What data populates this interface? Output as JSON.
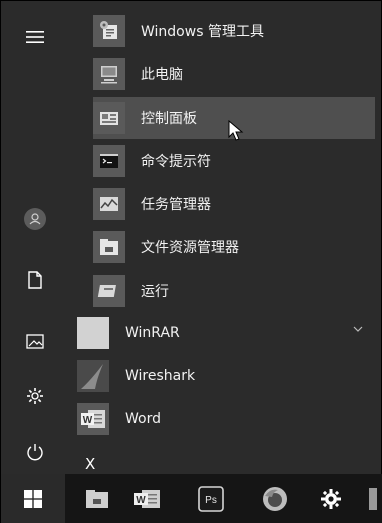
{
  "rail": {
    "icons": [
      "hamburger-icon",
      "user-avatar-icon",
      "document-icon",
      "pictures-icon",
      "settings-icon",
      "power-icon"
    ]
  },
  "menu": {
    "items": [
      {
        "label": "Windows 管理工具",
        "icon": "admin-tools-icon"
      },
      {
        "label": "此电脑",
        "icon": "this-pc-icon"
      },
      {
        "label": "控制面板",
        "icon": "control-panel-icon"
      },
      {
        "label": "命令提示符",
        "icon": "command-prompt-icon"
      },
      {
        "label": "任务管理器",
        "icon": "task-manager-icon"
      },
      {
        "label": "文件资源管理器",
        "icon": "file-explorer-icon"
      },
      {
        "label": "运行",
        "icon": "run-icon"
      },
      {
        "label": "WinRAR",
        "icon": "winrar-icon"
      },
      {
        "label": "Wireshark",
        "icon": "wireshark-icon"
      },
      {
        "label": "Word",
        "icon": "word-icon"
      }
    ],
    "section_letter": "X"
  },
  "taskbar": {
    "icons": [
      "windows-start-icon",
      "file-explorer-icon",
      "word-icon",
      "photoshop-icon",
      "firefox-icon",
      "settings-icon",
      "app-icon"
    ],
    "ps_text": "Ps",
    "word_letter": "W"
  },
  "colors": {
    "background": "#2b2b2b",
    "highlight": "#4f4f4f",
    "taskbar": "#151515",
    "text": "#f2f2f2"
  }
}
